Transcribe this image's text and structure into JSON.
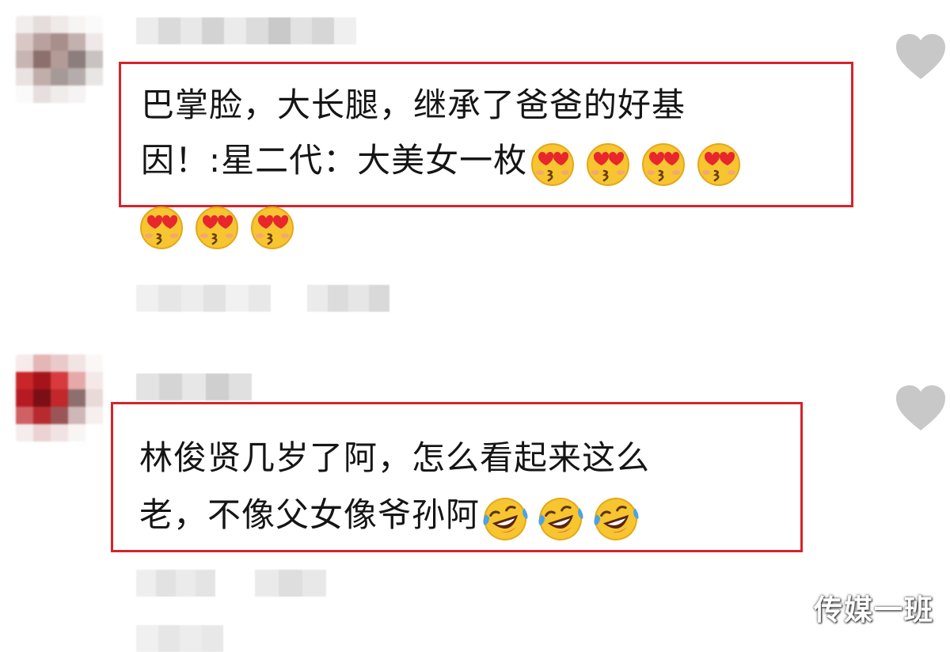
{
  "comments": [
    {
      "lines": [
        "巴掌脸，大长腿，继承了爸爸的好基",
        "因！:星二代：大美女一枚"
      ],
      "emoji_line2_count": 4,
      "emoji_line3_count": 3,
      "emoji_name": "heart-eyes-emoji"
    },
    {
      "lines": [
        "林俊贤几岁了阿，怎么看起来这么",
        "老，不像父女像爷孙阿"
      ],
      "emoji_line2_count": 3,
      "emoji_name": "laugh-cry-emoji"
    }
  ],
  "watermark": "传媒一班",
  "colors": {
    "highlight_box": "#d7232a",
    "like_icon": "#c8c8c8",
    "emoji_face": "#f6c530"
  }
}
